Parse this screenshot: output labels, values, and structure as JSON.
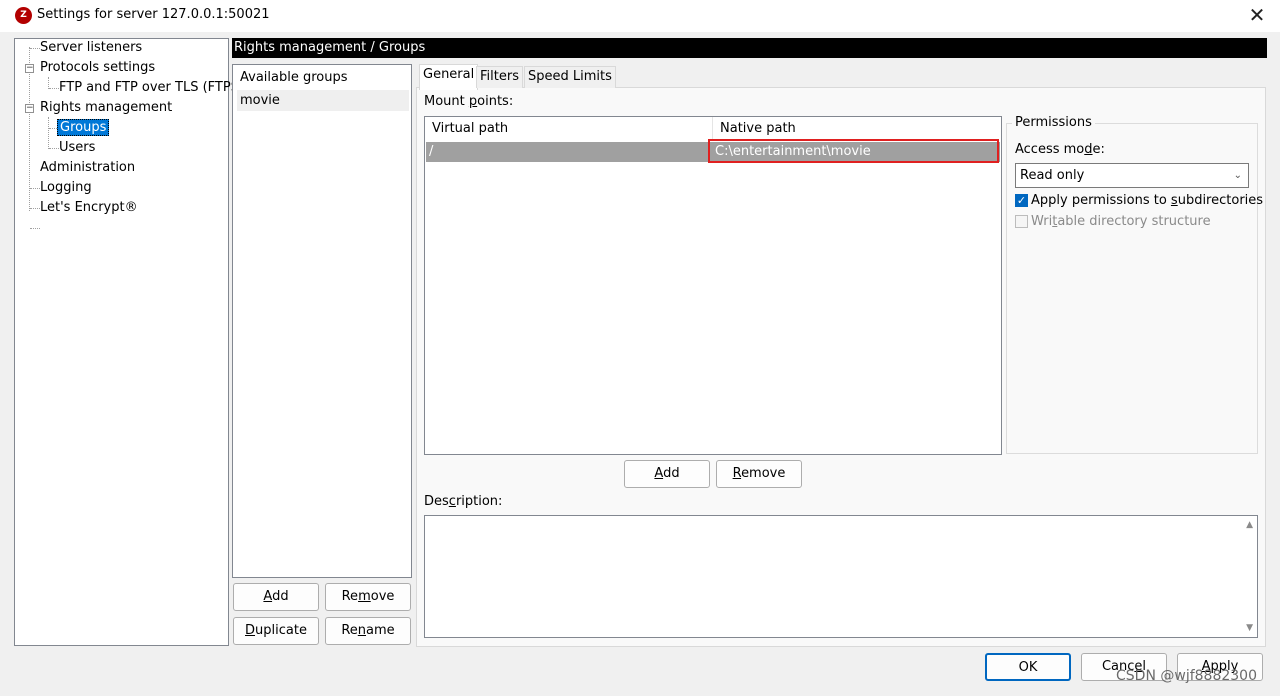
{
  "window": {
    "title": "Settings for server 127.0.0.1:50021",
    "app_icon": "filezilla-icon",
    "close_glyph": "✕"
  },
  "tree": {
    "items": [
      {
        "label": "Server listeners"
      },
      {
        "label": "Protocols settings"
      },
      {
        "label": "FTP and FTP over TLS (FTPS)"
      },
      {
        "label": "Rights management"
      },
      {
        "label": "Groups"
      },
      {
        "label": "Users"
      },
      {
        "label": "Administration"
      },
      {
        "label": "Logging"
      },
      {
        "label": "Let's Encrypt®"
      }
    ],
    "selected": "Groups"
  },
  "header": {
    "breadcrumb": "Rights management / Groups"
  },
  "groups": {
    "header": "Available groups",
    "items": [
      "movie"
    ],
    "buttons": {
      "add_u": "A",
      "add_rest": "dd",
      "remove_pre": "Re",
      "remove_u": "m",
      "remove_post": "ove",
      "duplicate_u": "D",
      "duplicate_rest": "uplicate",
      "rename_pre": "Re",
      "rename_u": "n",
      "rename_post": "ame"
    }
  },
  "tabs": [
    {
      "label": "General",
      "active": true
    },
    {
      "label": "Filters",
      "active": false
    },
    {
      "label": "Speed Limits",
      "active": false
    }
  ],
  "general": {
    "mount_label_pre": "Mount ",
    "mount_label_u": "p",
    "mount_label_post": "oints:",
    "columns": [
      "Virtual path",
      "Native path"
    ],
    "rows": [
      {
        "virtual": "/",
        "native": "C:\\entertainment\\movie"
      }
    ],
    "add_u": "A",
    "add_rest": "dd",
    "remove_u": "R",
    "remove_rest": "emove",
    "description_label_pre": "Des",
    "description_label_u": "c",
    "description_label_post": "ription:"
  },
  "permissions": {
    "title": "Permissions",
    "access_label_pre": "Access mo",
    "access_label_u": "d",
    "access_label_post": "e:",
    "access_value": "Read only",
    "apply_sub_pre": "Apply permissions to ",
    "apply_sub_u": "s",
    "apply_sub_post": "ubdirectories",
    "apply_sub_checked": true,
    "writable_pre": "Wri",
    "writable_u": "t",
    "writable_post": "able directory structure",
    "writable_checked": false
  },
  "footer": {
    "ok": "OK",
    "cancel_pre": "Canc",
    "cancel_u": "e",
    "cancel_post": "l",
    "apply_u": "A",
    "apply_rest": "pply"
  },
  "watermark": "CSDN @wjf8882300"
}
